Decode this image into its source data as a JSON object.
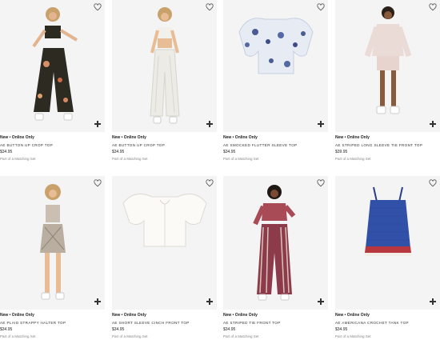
{
  "products": [
    {
      "badge": "New • Online Only",
      "name": "AE Button Up Crop Top",
      "price": "$34.95",
      "note": "Part of a Matching Set"
    },
    {
      "badge": "New • Online Only",
      "name": "AE Button Up Crop Top",
      "price": "$34.95",
      "note": "Part of a Matching Set"
    },
    {
      "badge": "New • Online Only",
      "name": "AE Smocked Flutter Sleeve Top",
      "price": "$34.95",
      "note": "Part of a Matching Set"
    },
    {
      "badge": "New • Online Only",
      "name": "AE Striped Long Sleeve Tie Front Top",
      "price": "$39.95",
      "note": "Part of a Matching Set"
    },
    {
      "badge": "New • Online Only",
      "name": "AE Plaid Strappy Halter Top",
      "price": "$34.95",
      "note": "Part of a Matching Set"
    },
    {
      "badge": "New • Online Only",
      "name": "AE Short Sleeve Cinch Front Top",
      "price": "$34.95",
      "note": "Part of a Matching Set"
    },
    {
      "badge": "New • Online Only",
      "name": "AE Striped Tie Front Top",
      "price": "$34.95",
      "note": "Part of a Matching Set"
    },
    {
      "badge": "New • Online Only",
      "name": "AE Americana Crochet Tank Top",
      "price": "$34.95",
      "note": "Part of a Matching Set"
    }
  ],
  "icons": {
    "favorite": "heart-outline-icon",
    "add": "plus-icon"
  },
  "colors": {
    "image_bg": "#f4f4f4",
    "text": "#222222",
    "muted": "#888888"
  }
}
